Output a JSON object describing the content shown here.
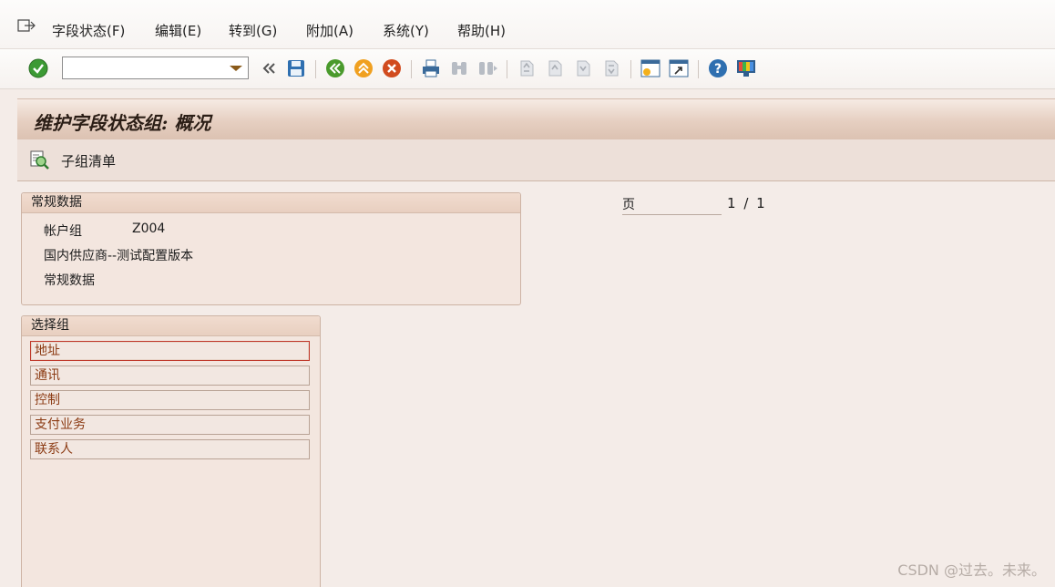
{
  "menu": {
    "items": [
      "字段状态(F)",
      "编辑(E)",
      "转到(G)",
      "附加(A)",
      "系统(Y)",
      "帮助(H)"
    ]
  },
  "toolbar": {
    "command_value": "",
    "icons": [
      "check-icon",
      "back-icon",
      "save-icon",
      "green-back-icon",
      "up-icon",
      "cancel-icon",
      "print-icon",
      "find-icon",
      "find-next-icon",
      "first-page-icon",
      "prev-page-icon",
      "next-page-icon",
      "last-page-icon",
      "new-session-icon",
      "shortcut-icon",
      "help-icon",
      "customize-icon"
    ]
  },
  "title": "维护字段状态组: 概况",
  "app_toolbar": {
    "subgroup_list": "子组清单"
  },
  "general_data": {
    "header": "常规数据",
    "account_group_label": "帐户组",
    "account_group_value": "Z004",
    "description": "国内供应商--测试配置版本",
    "section_label": "常规数据"
  },
  "page": {
    "label": "页",
    "current": "1",
    "separator": "/",
    "total": "1"
  },
  "select_group": {
    "header": "选择组",
    "items": [
      "地址",
      "通讯",
      "控制",
      "支付业务",
      "联系人"
    ]
  },
  "watermark": "CSDN @过去。未来。",
  "colors": {
    "accent": "#8b3a12",
    "title_bg": "#e6cfc1",
    "background": "#f4ece8"
  }
}
